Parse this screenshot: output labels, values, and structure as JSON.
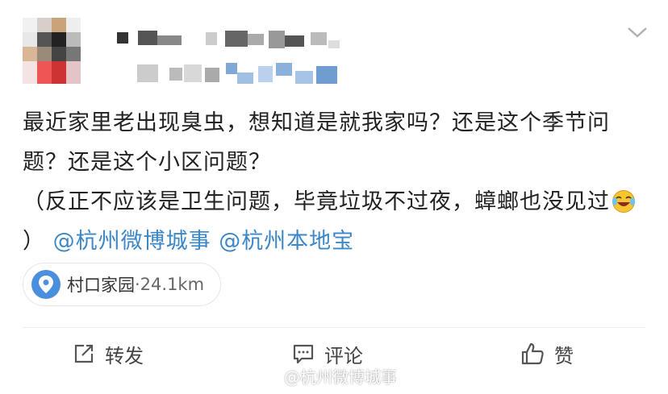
{
  "post": {
    "content_parts": [
      "最近家里老出现臭虫，想知道是就我家吗？还是这个季节问题？还是这个小区问题？",
      "（反正不应该是卫生问题，毕竟垃圾不过夜，蟑螂也没见过",
      "）"
    ],
    "emoji_name": "laughing-crying-emoji",
    "mentions": [
      "@杭州微博城事",
      "@杭州本地宝"
    ],
    "location": {
      "name": "村口家园",
      "distance": "·24.1km"
    }
  },
  "actions": {
    "repost": "转发",
    "comment": "评论",
    "like": "赞"
  },
  "watermark": "@杭州微博城事",
  "colors": {
    "link": "#3b87c8",
    "pin": "#4a8fde"
  }
}
